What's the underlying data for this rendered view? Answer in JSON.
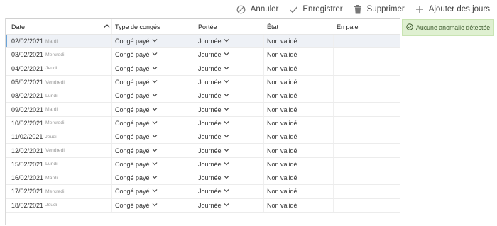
{
  "toolbar": {
    "cancel_label": "Annuler",
    "save_label": "Enregistrer",
    "delete_label": "Supprimer",
    "add_label": "Ajouter des jours"
  },
  "table": {
    "headers": {
      "date": "Date",
      "type": "Type de congés",
      "portee": "Portée",
      "etat": "État",
      "paie": "En paie"
    },
    "rows": [
      {
        "date": "02/02/2021",
        "day": "Mardi",
        "type": "Congé payé",
        "portee": "Journée",
        "etat": "Non validé",
        "paie": ""
      },
      {
        "date": "03/02/2021",
        "day": "Mercredi",
        "type": "Congé payé",
        "portee": "Journée",
        "etat": "Non validé",
        "paie": ""
      },
      {
        "date": "04/02/2021",
        "day": "Jeudi",
        "type": "Congé payé",
        "portee": "Journée",
        "etat": "Non validé",
        "paie": ""
      },
      {
        "date": "05/02/2021",
        "day": "Vendredi",
        "type": "Congé payé",
        "portee": "Journée",
        "etat": "Non validé",
        "paie": ""
      },
      {
        "date": "08/02/2021",
        "day": "Lundi",
        "type": "Congé payé",
        "portee": "Journée",
        "etat": "Non validé",
        "paie": ""
      },
      {
        "date": "09/02/2021",
        "day": "Mardi",
        "type": "Congé payé",
        "portee": "Journée",
        "etat": "Non validé",
        "paie": ""
      },
      {
        "date": "10/02/2021",
        "day": "Mercredi",
        "type": "Congé payé",
        "portee": "Journée",
        "etat": "Non validé",
        "paie": ""
      },
      {
        "date": "11/02/2021",
        "day": "Jeudi",
        "type": "Congé payé",
        "portee": "Journée",
        "etat": "Non validé",
        "paie": ""
      },
      {
        "date": "12/02/2021",
        "day": "Vendredi",
        "type": "Congé payé",
        "portee": "Journée",
        "etat": "Non validé",
        "paie": ""
      },
      {
        "date": "15/02/2021",
        "day": "Lundi",
        "type": "Congé payé",
        "portee": "Journée",
        "etat": "Non validé",
        "paie": ""
      },
      {
        "date": "16/02/2021",
        "day": "Mardi",
        "type": "Congé payé",
        "portee": "Journée",
        "etat": "Non validé",
        "paie": ""
      },
      {
        "date": "17/02/2021",
        "day": "Mercredi",
        "type": "Congé payé",
        "portee": "Journée",
        "etat": "Non validé",
        "paie": ""
      },
      {
        "date": "18/02/2021",
        "day": "Jeudi",
        "type": "Congé payé",
        "portee": "Journée",
        "etat": "Non validé",
        "paie": ""
      }
    ]
  },
  "status": {
    "message": "Aucune anomalie détectée",
    "color": "#dff0d1"
  },
  "icons": {
    "cancel": "cancel-icon",
    "save": "check-icon",
    "delete": "trash-icon",
    "add": "plus-icon",
    "sort": "chevron-up-icon",
    "dropdown": "chevron-down-icon",
    "status": "check-circle-icon"
  }
}
